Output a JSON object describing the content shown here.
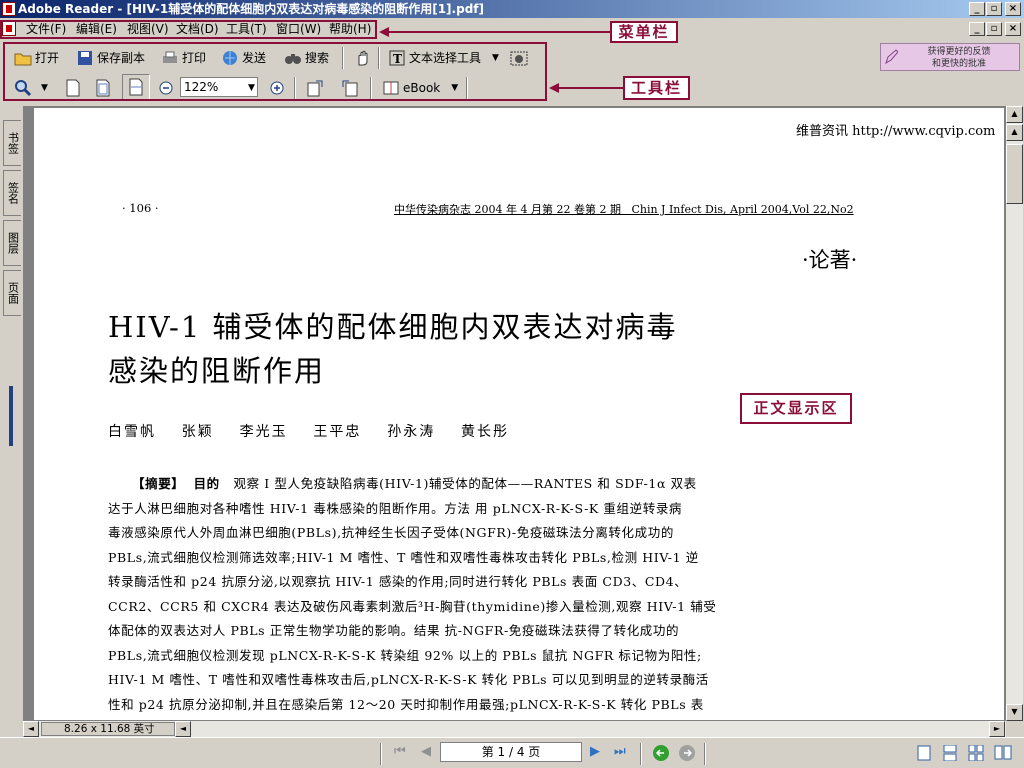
{
  "window": {
    "title": "Adobe Reader - [HIV-1辅受体的配体细胞内双表达对病毒感染的阻断作用[1].pdf]"
  },
  "menu": {
    "items": [
      "文件(F)",
      "编辑(E)",
      "视图(V)",
      "文档(D)",
      "工具(T)",
      "窗口(W)",
      "帮助(H)"
    ]
  },
  "annotations": {
    "menubar_label": "菜单栏",
    "toolbar_label": "工具栏",
    "body_label": "正文显示区"
  },
  "toolbar1": {
    "open": "打开",
    "save_copy": "保存副本",
    "print": "打印",
    "send": "发送",
    "search": "搜索",
    "text_select": "文本选择工具"
  },
  "toolbar2": {
    "zoom_value": "122%",
    "ebook": "eBook"
  },
  "feedback": {
    "line1": "获得更好的反馈",
    "line2": "和更快的批准"
  },
  "nav_tabs": [
    "书签",
    "签名",
    "图层",
    "页面"
  ],
  "document": {
    "watermark": "维普资讯 http://www.cqvip.com",
    "page_number": "· 106 ·",
    "journal_header": "中华传染病杂志 2004 年 4 月第 22 卷第 2 期   Chin J Infect Dis, April 2004,Vol 22,No2",
    "section": "·论著·",
    "title_line1": "HIV-1 辅受体的配体细胞内双表达对病毒",
    "title_line2": "感染的阻断作用",
    "authors": "白雪帆    张颖    李光玉    王平忠    孙永涛    黄长彤",
    "abstract_label": "【摘要】",
    "objective_label": "目的",
    "abstract_lines": [
      "观察 I 型人免疫缺陷病毒(HIV-1)辅受体的配体——RANTES 和 SDF-1α 双表",
      "达于人淋巴细胞对各种嗜性 HIV-1 毒株感染的阻断作用。方法  用 pLNCX-R-K-S-K 重组逆转录病",
      "毒液感染原代人外周血淋巴细胞(PBLs),抗神经生长因子受体(NGFR)-免疫磁珠法分离转化成功的",
      "PBLs,流式细胞仪检测筛选效率;HIV-1 M 嗜性、T 嗜性和双嗜性毒株攻击转化 PBLs,检测 HIV-1 逆",
      "转录酶活性和 p24 抗原分泌,以观察抗 HIV-1 感染的作用;同时进行转化 PBLs 表面 CD3、CD4、",
      "CCR2、CCR5 和 CXCR4 表达及破伤风毒素刺激后³H-胸苷(thymidine)掺入量检测,观察 HIV-1 辅受",
      "体配体的双表达对人 PBLs 正常生物学功能的影响。结果  抗-NGFR-免疫磁珠法获得了转化成功的",
      "PBLs,流式细胞仪检测发现 pLNCX-R-K-S-K 转染组 92% 以上的 PBLs 鼠抗 NGFR 标记物为阳性;",
      "HIV-1 M 嗜性、T 嗜性和双嗜性毒株攻击后,pLNCX-R-K-S-K 转化 PBLs 可以见到明显的逆转录酶活",
      "性和 p24 抗原分泌抑制,并且在感染后第 12～20 天时抑制作用最强;pLNCX-R-K-S-K 转化 PBLs 表"
    ]
  },
  "status": {
    "page_size": "8.26 x 11.68 英寸",
    "page_indicator": "第 1 / 4 页"
  }
}
